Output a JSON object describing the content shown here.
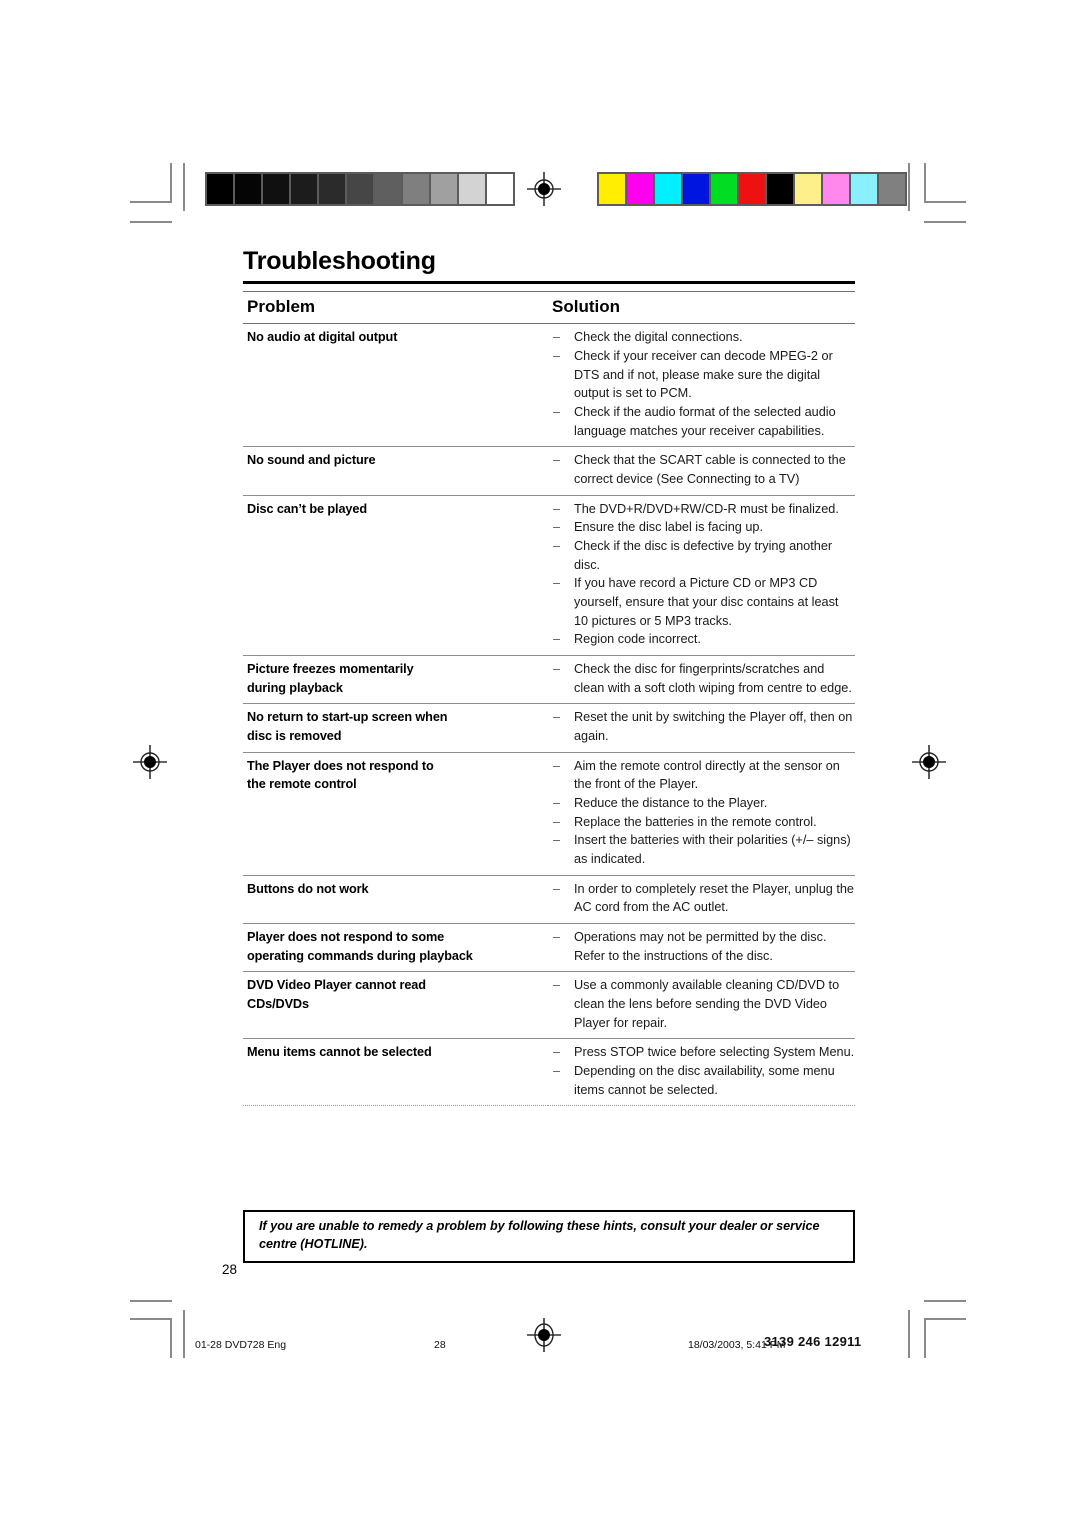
{
  "page": {
    "title": "Troubleshooting",
    "folio": "28"
  },
  "table": {
    "headers": {
      "problem": "Problem",
      "solution": "Solution"
    },
    "dash": "–",
    "rows": [
      {
        "problem": [
          "No audio at digital output"
        ],
        "solutions": [
          "Check the digital connections.",
          "Check if your receiver can decode MPEG-2 or DTS and if not, please make sure the digital output is set to PCM.",
          "Check if the audio format of the selected audio language matches your receiver capabilities."
        ]
      },
      {
        "problem": [
          "No sound and picture"
        ],
        "solutions": [
          "Check that the SCART cable is connected to the correct device (See Connecting to a TV)"
        ]
      },
      {
        "problem": [
          "Disc can’t be played"
        ],
        "solutions": [
          "The DVD+R/DVD+RW/CD-R must be finalized.",
          "Ensure the disc label is facing up.",
          "Check if the disc is defective by trying another disc.",
          "If you have record a Picture CD or MP3 CD yourself, ensure that your disc contains at least 10 pictures or 5 MP3 tracks.",
          "Region code incorrect."
        ]
      },
      {
        "problem": [
          "Picture freezes momentarily",
          "during playback"
        ],
        "solutions": [
          "Check the disc for fingerprints/scratches and clean with a soft cloth wiping from centre to edge."
        ]
      },
      {
        "problem": [
          "No return to start-up screen when",
          "disc is removed"
        ],
        "solutions": [
          "Reset the unit by switching the Player off, then on again."
        ]
      },
      {
        "problem": [
          "The Player does not respond to",
          "the remote control"
        ],
        "solutions": [
          "Aim the remote control directly at the sensor on the front of the Player.",
          "Reduce the distance to the Player.",
          "Replace the batteries in the remote control.",
          "Insert the batteries with their polarities (+/– signs) as indicated."
        ]
      },
      {
        "problem": [
          "Buttons do not work"
        ],
        "solutions": [
          "In order to completely reset the Player, unplug the AC cord from the AC outlet."
        ]
      },
      {
        "problem": [
          "Player does not respond to some",
          "operating commands during playback"
        ],
        "solutions": [
          "Operations may not be permitted by the disc. Refer to the instructions of  the disc."
        ]
      },
      {
        "problem": [
          "DVD Video Player cannot read",
          "CDs/DVDs"
        ],
        "solutions": [
          "Use a commonly available cleaning CD/DVD to clean the lens before sending the DVD Video Player for repair."
        ]
      },
      {
        "problem": [
          "Menu items cannot be selected"
        ],
        "solutions": [
          "Press STOP twice before selecting System Menu.",
          "Depending on the disc availability, some menu items cannot be selected."
        ]
      }
    ]
  },
  "hotline": {
    "text": "If you are unable to remedy a problem by following these hints, consult your dealer or service centre (HOTLINE)."
  },
  "colophon": {
    "file": "01-28 DVD728 Eng",
    "page": "28",
    "timestamp": "18/03/2003, 5:41 PM",
    "part_number": "3139 246 12911"
  },
  "calibration": {
    "grayscale_swatches": [
      "#000000",
      "#050505",
      "#101010",
      "#1c1c1c",
      "#2b2b2b",
      "#464646",
      "#5f5f5f",
      "#7f7f7f",
      "#a0a0a0",
      "#d3d3d3",
      "#ffffff"
    ],
    "color_swatches": [
      "#ffee00",
      "#ff00ee",
      "#00f0ff",
      "#0015e0",
      "#00dd22",
      "#ee1111",
      "#000000",
      "#fdf08a",
      "#ff88ee",
      "#88f0ff",
      "#808080"
    ]
  }
}
